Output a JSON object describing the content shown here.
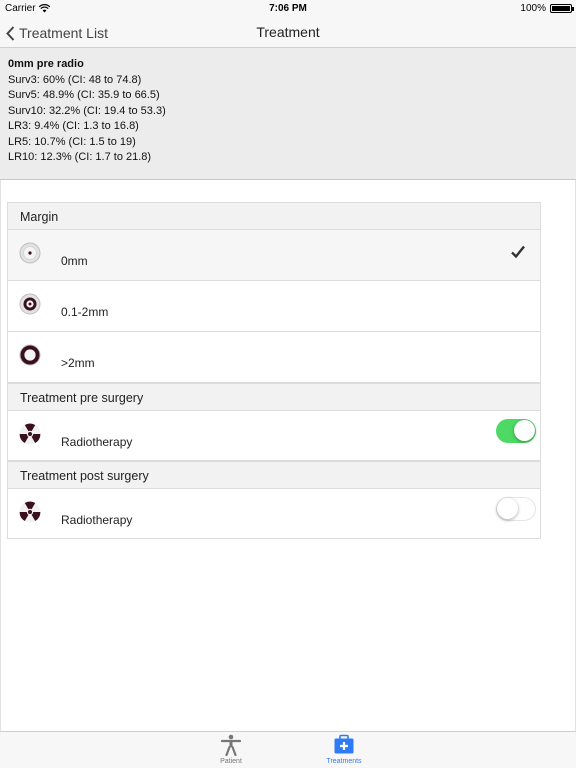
{
  "status_bar": {
    "carrier": "Carrier",
    "time": "7:06 PM",
    "battery": "100%"
  },
  "nav": {
    "back_label": "Treatment List",
    "title": "Treatment"
  },
  "summary": {
    "heading": "0mm pre radio",
    "lines": [
      "Surv3: 60% (CI: 48 to 74.8)",
      "Surv5: 48.9% (CI: 35.9 to 66.5)",
      "Surv10: 32.2% (CI: 19.4 to 53.3)",
      "LR3: 9.4% (CI: 1.3 to 16.8)",
      "LR5: 10.7% (CI: 1.5 to 19)",
      "LR10: 12.3% (CI: 1.7 to 21.8)"
    ]
  },
  "margin_section": {
    "header": "Margin",
    "options": [
      {
        "label": "0mm",
        "selected": true
      },
      {
        "label": "0.1-2mm",
        "selected": false
      },
      {
        "label": ">2mm",
        "selected": false
      }
    ]
  },
  "pre_surgery": {
    "header": "Treatment pre surgery",
    "label": "Radiotherapy",
    "enabled": true
  },
  "post_surgery": {
    "header": "Treatment post surgery",
    "label": "Radiotherapy",
    "enabled": false
  },
  "tabs": [
    {
      "label": "Patient",
      "active": false
    },
    {
      "label": "Treatments",
      "active": true
    }
  ],
  "colors": {
    "toggle_on": "#4cd964",
    "accent": "#2f7bf5"
  }
}
